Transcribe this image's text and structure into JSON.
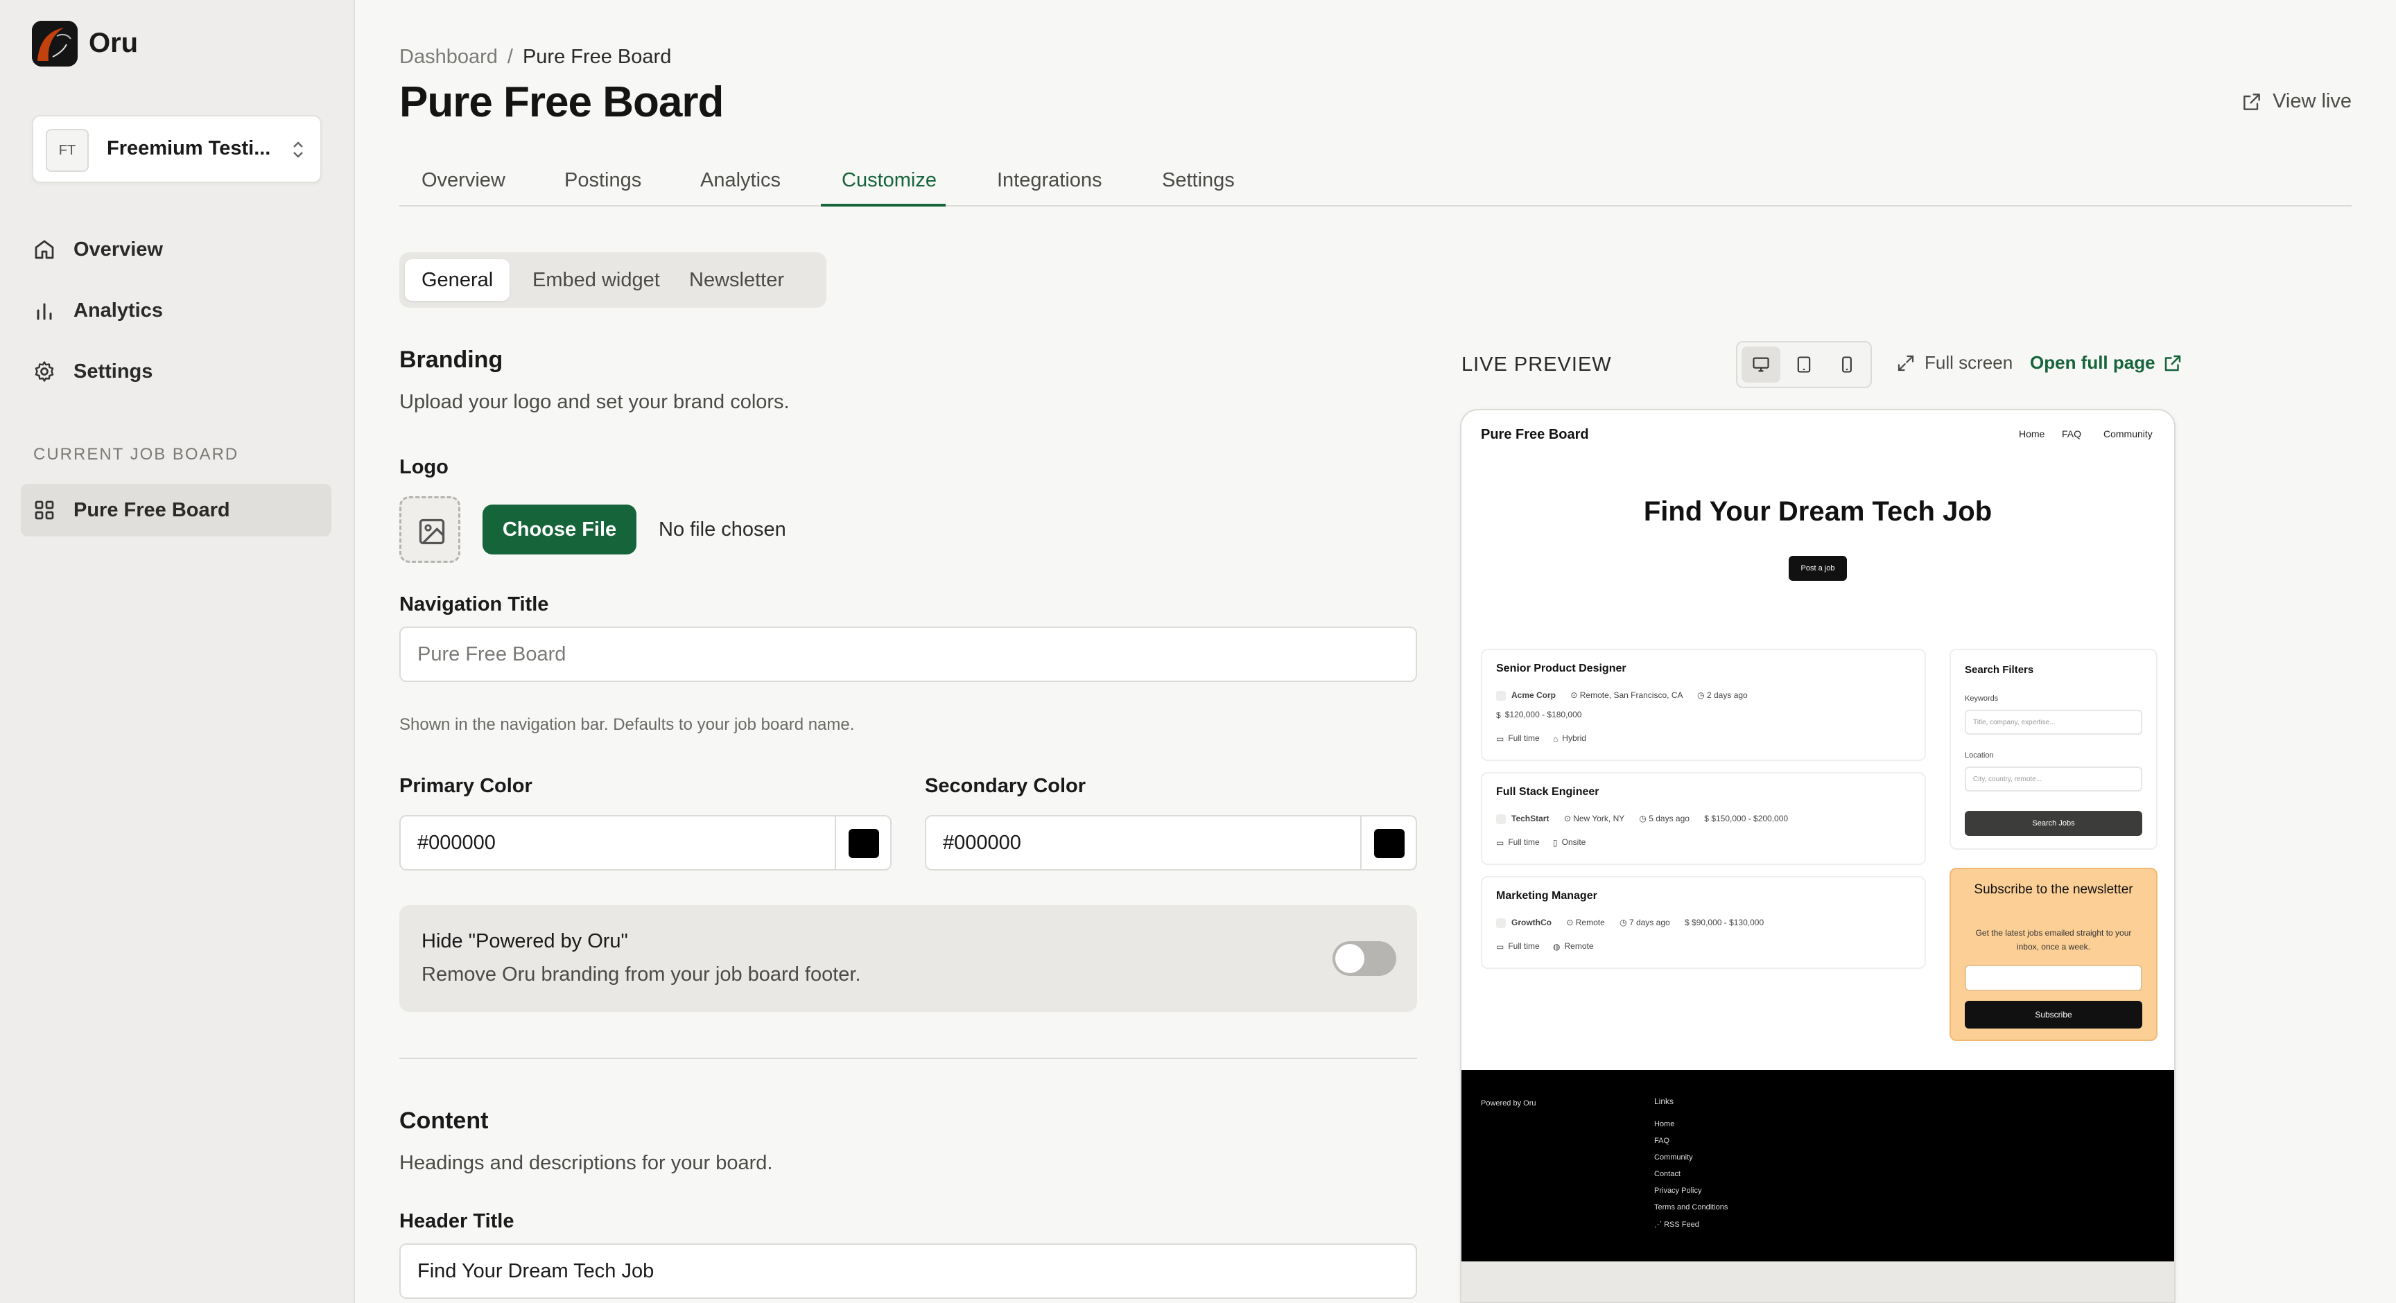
{
  "app": {
    "name": "Oru"
  },
  "workspace": {
    "initials": "FT",
    "name": "Freemium Testi..."
  },
  "sidebar": {
    "items": [
      {
        "label": "Overview",
        "icon": "home-icon"
      },
      {
        "label": "Analytics",
        "icon": "bar-chart-icon"
      },
      {
        "label": "Settings",
        "icon": "gear-icon"
      }
    ],
    "section_label": "CURRENT JOB BOARD",
    "current_board": "Pure Free Board"
  },
  "breadcrumb": {
    "root": "Dashboard",
    "sep": "/",
    "current": "Pure Free Board"
  },
  "page": {
    "title": "Pure Free Board",
    "view_live": "View live"
  },
  "tabs": [
    "Overview",
    "Postings",
    "Analytics",
    "Customize",
    "Integrations",
    "Settings"
  ],
  "subtabs": [
    "General",
    "Embed widget",
    "Newsletter"
  ],
  "branding": {
    "title": "Branding",
    "desc": "Upload your logo and set your brand colors.",
    "logo_label": "Logo",
    "choose_file": "Choose File",
    "no_file": "No file chosen",
    "nav_title_label": "Navigation Title",
    "nav_title_placeholder": "Pure Free Board",
    "nav_title_help": "Shown in the navigation bar. Defaults to your job board name.",
    "primary_label": "Primary Color",
    "primary_value": "#000000",
    "secondary_label": "Secondary Color",
    "secondary_value": "#000000",
    "hide_title": "Hide \"Powered by Oru\"",
    "hide_desc": "Remove Oru branding from your job board footer.",
    "hide_enabled": false
  },
  "content": {
    "title": "Content",
    "desc": "Headings and descriptions for your board.",
    "header_title_label": "Header Title",
    "header_title_value": "Find Your Dream Tech Job"
  },
  "preview": {
    "label": "LIVE PREVIEW",
    "full_screen": "Full screen",
    "open_full_page": "Open full page",
    "brand": "Pure Free Board",
    "nav": [
      "Home",
      "FAQ",
      "Community"
    ],
    "hero": "Find Your Dream Tech Job",
    "post_job": "Post a job",
    "jobs": [
      {
        "title": "Senior Product Designer",
        "company": "Acme Corp",
        "location": "Remote, San Francisco, CA",
        "posted": "2 days ago",
        "salary": "$120,000 - $180,000",
        "type": "Full time",
        "mode": "Hybrid"
      },
      {
        "title": "Full Stack Engineer",
        "company": "TechStart",
        "location": "New York, NY",
        "posted": "5 days ago",
        "salary": "$150,000 - $200,000",
        "type": "Full time",
        "mode": "Onsite"
      },
      {
        "title": "Marketing Manager",
        "company": "GrowthCo",
        "location": "Remote",
        "posted": "7 days ago",
        "salary": "$90,000 - $130,000",
        "type": "Full time",
        "mode": "Remote"
      }
    ],
    "filters": {
      "title": "Search Filters",
      "keywords_label": "Keywords",
      "keywords_placeholder": "Title, company, expertise...",
      "location_label": "Location",
      "location_placeholder": "City, country, remote...",
      "button": "Search Jobs"
    },
    "newsletter": {
      "title": "Subscribe to the newsletter",
      "desc": "Get the latest jobs emailed straight to your inbox, once a week.",
      "button": "Subscribe"
    },
    "footer": {
      "powered": "Powered by Oru",
      "links_heading": "Links",
      "links": [
        "Home",
        "FAQ",
        "Community",
        "Contact",
        "Privacy Policy",
        "Terms and Conditions",
        "RSS Feed"
      ]
    }
  },
  "colors": {
    "accent": "#15643a",
    "newsletter_bg": "#fbcf95"
  }
}
